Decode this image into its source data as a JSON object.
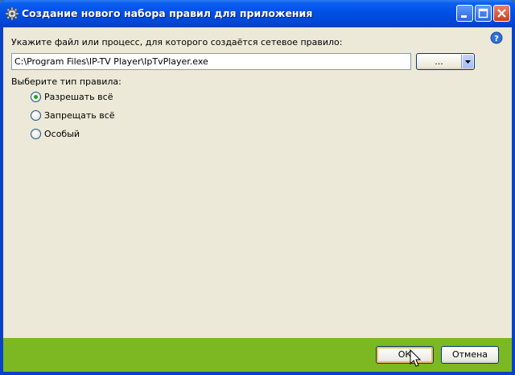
{
  "window": {
    "title": "Создание нового набора правил для приложения",
    "icons": {
      "app": "gear-icon",
      "help": "help-icon"
    },
    "controls": {
      "minimize": "minimize-icon",
      "maximize": "maximize-icon",
      "close": "close-icon"
    }
  },
  "form": {
    "file_prompt": "Укажите файл или процесс, для которого создаётся сетевое правило:",
    "file_path": "C:\\Program Files\\IP-TV Player\\IpTvPlayer.exe",
    "browse_label": "...",
    "rule_type_label": "Выберите тип правила:",
    "rule_options": [
      {
        "label": "Разрешать всё",
        "selected": true
      },
      {
        "label": "Запрещать всё",
        "selected": false
      },
      {
        "label": "Особый",
        "selected": false
      }
    ]
  },
  "footer": {
    "ok_label": "ОК",
    "cancel_label": "Отмена"
  },
  "colors": {
    "titlebar": "#0050e6",
    "footer": "#7cb822",
    "dialog_bg": "#ece9d8",
    "radio_dot": "#21a121"
  }
}
